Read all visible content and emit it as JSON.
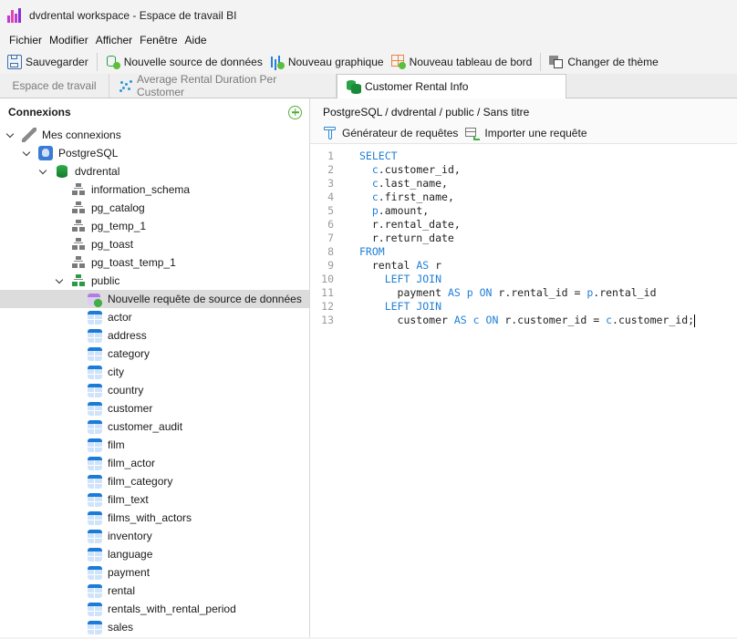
{
  "window": {
    "title": "dvdrental workspace - Espace de travail BI"
  },
  "menubar": {
    "items": [
      "Fichier",
      "Modifier",
      "Afficher",
      "Fenêtre",
      "Aide"
    ]
  },
  "toolbar": {
    "save_label": "Sauvegarder",
    "new_datasource_label": "Nouvelle source de données",
    "new_chart_label": "Nouveau graphique",
    "new_dashboard_label": "Nouveau tableau de bord",
    "change_theme_label": "Changer de thème"
  },
  "tabs": [
    {
      "label": "Espace de travail",
      "active": false
    },
    {
      "label": "Average Rental Duration Per Customer",
      "active": false
    },
    {
      "label": "Customer Rental Info",
      "active": true
    }
  ],
  "sidebar": {
    "title": "Connexions",
    "root": "Mes connexions",
    "connection": "PostgreSQL",
    "database": "dvdrental",
    "schemas": [
      "information_schema",
      "pg_catalog",
      "pg_temp_1",
      "pg_toast",
      "pg_toast_temp_1"
    ],
    "public_schema": "public",
    "new_query": "Nouvelle requête de source de données",
    "tables": [
      "actor",
      "address",
      "category",
      "city",
      "country",
      "customer",
      "customer_audit",
      "film",
      "film_actor",
      "film_category",
      "film_text",
      "films_with_actors",
      "inventory",
      "language",
      "payment",
      "rental",
      "rentals_with_rental_period",
      "sales"
    ]
  },
  "content": {
    "breadcrumb": "PostgreSQL / dvdrental / public / Sans titre",
    "query_builder_label": "Générateur de requêtes",
    "import_query_label": "Importer une requête",
    "colors": {
      "keyword": "#1f7fd6",
      "line_number": "#9a9a9a"
    },
    "code_lines": [
      [
        {
          "t": "SELECT",
          "k": 1
        }
      ],
      [
        {
          "t": "  "
        },
        {
          "t": "c",
          "k": 1
        },
        {
          "t": ".customer_id,"
        }
      ],
      [
        {
          "t": "  "
        },
        {
          "t": "c",
          "k": 1
        },
        {
          "t": ".last_name,"
        }
      ],
      [
        {
          "t": "  "
        },
        {
          "t": "c",
          "k": 1
        },
        {
          "t": ".first_name,"
        }
      ],
      [
        {
          "t": "  "
        },
        {
          "t": "p",
          "k": 1
        },
        {
          "t": ".amount,"
        }
      ],
      [
        {
          "t": "  r.rental_date,"
        }
      ],
      [
        {
          "t": "  r.return_date"
        }
      ],
      [
        {
          "t": "FROM",
          "k": 1
        }
      ],
      [
        {
          "t": "  rental "
        },
        {
          "t": "AS",
          "k": 1
        },
        {
          "t": " r"
        }
      ],
      [
        {
          "t": "    "
        },
        {
          "t": "LEFT JOIN",
          "k": 1
        }
      ],
      [
        {
          "t": "      payment "
        },
        {
          "t": "AS",
          "k": 1
        },
        {
          "t": " "
        },
        {
          "t": "p",
          "k": 1
        },
        {
          "t": " "
        },
        {
          "t": "ON",
          "k": 1
        },
        {
          "t": " r.rental_id = "
        },
        {
          "t": "p",
          "k": 1
        },
        {
          "t": ".rental_id"
        }
      ],
      [
        {
          "t": "    "
        },
        {
          "t": "LEFT JOIN",
          "k": 1
        }
      ],
      [
        {
          "t": "      customer "
        },
        {
          "t": "AS",
          "k": 1
        },
        {
          "t": " "
        },
        {
          "t": "c",
          "k": 1
        },
        {
          "t": " "
        },
        {
          "t": "ON",
          "k": 1
        },
        {
          "t": " r.customer_id = "
        },
        {
          "t": "c",
          "k": 1
        },
        {
          "t": ".customer_id;"
        }
      ]
    ]
  }
}
